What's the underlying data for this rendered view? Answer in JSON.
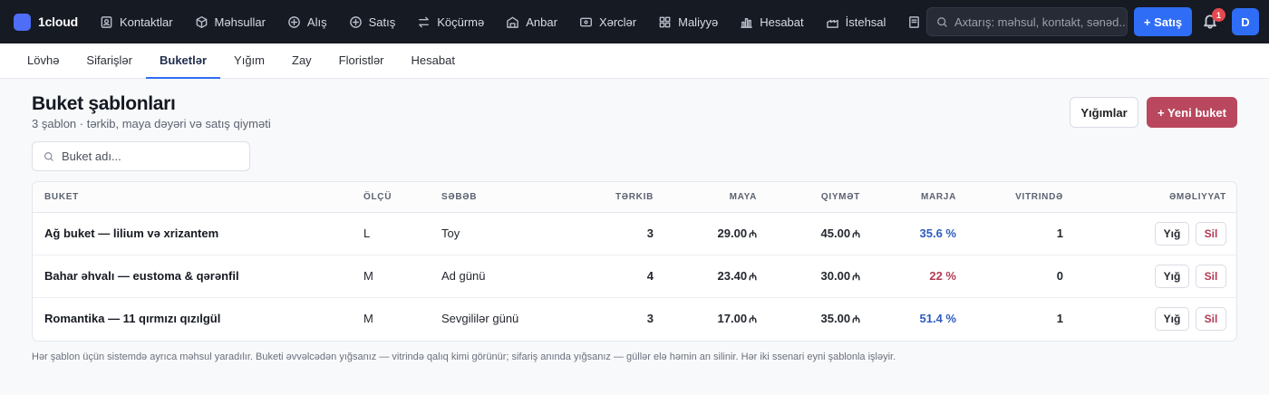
{
  "app": {
    "name": "1cloud",
    "brand_color": "#4f6ef7"
  },
  "nav": [
    {
      "label": "Kontaktlar",
      "icon": "contacts-icon"
    },
    {
      "label": "Məhsullar",
      "icon": "box-icon"
    },
    {
      "label": "Alış",
      "icon": "plus-circle-icon"
    },
    {
      "label": "Satış",
      "icon": "plus-circle-icon"
    },
    {
      "label": "Köçürmə",
      "icon": "transfer-icon"
    },
    {
      "label": "Anbar",
      "icon": "warehouse-icon"
    },
    {
      "label": "Xərclər",
      "icon": "wallet-icon"
    },
    {
      "label": "Maliyyə",
      "icon": "grid-icon"
    },
    {
      "label": "Hesabat",
      "icon": "bar-chart-icon"
    },
    {
      "label": "İstehsal",
      "icon": "factory-icon"
    }
  ],
  "header": {
    "search_placeholder": "Axtarış: məhsul, kontakt, sənəd...",
    "sale_button": "+ Satış",
    "notifications_count": "1",
    "avatar_initial": "D"
  },
  "tabs": [
    {
      "label": "Lövhə",
      "active": false
    },
    {
      "label": "Sifarişlər",
      "active": false
    },
    {
      "label": "Buketlər",
      "active": true
    },
    {
      "label": "Yığım",
      "active": false
    },
    {
      "label": "Zay",
      "active": false
    },
    {
      "label": "Floristlər",
      "active": false
    },
    {
      "label": "Hesabat",
      "active": false
    }
  ],
  "page": {
    "title": "Buket şablonları",
    "subtitle": "3 şablon · tərkib, maya dəyəri və satış qiyməti",
    "assemblies_button": "Yığımlar",
    "new_button": "+ Yeni buket",
    "filter_placeholder": "Buket adı..."
  },
  "table": {
    "headers": {
      "bouquet": "Buket",
      "size": "Ölçü",
      "occasion": "Səbəb",
      "composition": "Tərkib",
      "cost": "Maya",
      "price": "Qiymət",
      "margin": "Marja",
      "showcase": "Vitrində",
      "actions": "Əməliyyat"
    },
    "currency_symbol": "₼",
    "assemble_label": "Yığ",
    "delete_label": "Sil",
    "rows": [
      {
        "name": "Ağ buket — lilium və xrizantem",
        "size": "L",
        "occasion": "Toy",
        "composition": "3",
        "cost": "29.00",
        "price": "45.00",
        "margin": "35.6 %",
        "margin_tone": "positive",
        "showcase": "1"
      },
      {
        "name": "Bahar əhvalı — eustoma & qərənfil",
        "size": "M",
        "occasion": "Ad günü",
        "composition": "4",
        "cost": "23.40",
        "price": "30.00",
        "margin": "22 %",
        "margin_tone": "low",
        "showcase": "0"
      },
      {
        "name": "Romantika — 11 qırmızı qızılgül",
        "size": "M",
        "occasion": "Sevgililər günü",
        "composition": "3",
        "cost": "17.00",
        "price": "35.00",
        "margin": "51.4 %",
        "margin_tone": "positive",
        "showcase": "1"
      }
    ]
  },
  "footnote": "Hər şablon üçün sistemdə ayrıca məhsul yaradılır. Buketi əvvəlcədən yığsanız — vitrində qalıq kimi görünür; sifariş anında yığsanız — güllər elə həmin an silinir. Hər iki ssenari eyni şablonla işləyir."
}
